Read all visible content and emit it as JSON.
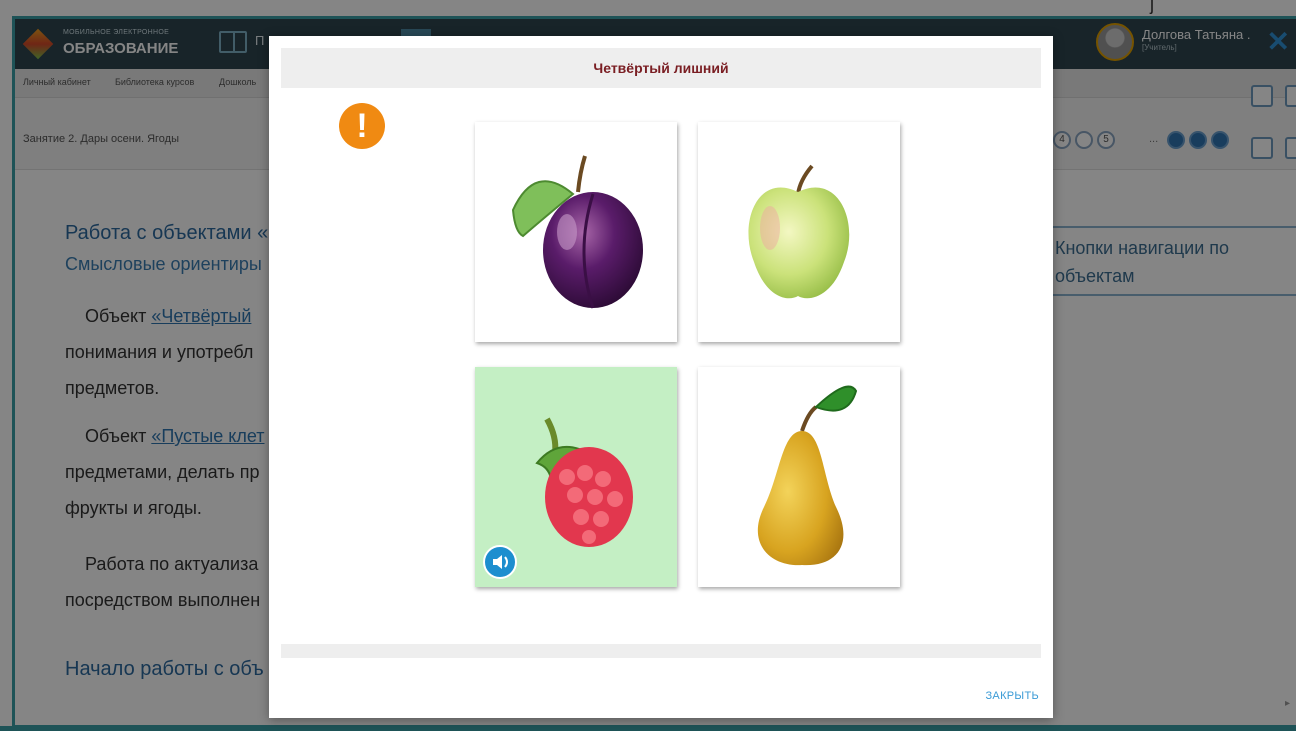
{
  "app": {
    "logo_small": "МОБИЛЬНОЕ ЭЛЕКТРОННОЕ",
    "logo_big": "ОБРАЗОВАНИЕ",
    "nav_label": "П",
    "user_name": "Долгова Татьяна .",
    "user_role": "[Учитель]"
  },
  "breadcrumbs": [
    "Личный кабинет",
    "Библиотека курсов",
    "Дошколь"
  ],
  "lesson_title": "Занятие 2. Дары осени. Ягоды",
  "pager": {
    "four": "4",
    "five": "5",
    "dots": "..."
  },
  "content": {
    "heading_work": "Работа с объектами «",
    "subheading": "Смысловые ориентиры",
    "p1_start": "Объект ",
    "p1_link": "«Четвёртый",
    "p1_line2": "понимания и употребл",
    "p1_line3": "предметов.",
    "p2_start": "Объект ",
    "p2_link": "«Пустые клет",
    "p2_line2": "предметами, делать пр",
    "p2_line3": "фрукты и ягоды.",
    "p3_line1": "Работа по актуализа",
    "p3_line2": "посредством выполнен",
    "heading_start": "Начало работы с объ",
    "nav_note": "Кнопки навигации по объектам"
  },
  "modal": {
    "title": "Четвёртый лишний",
    "warning_glyph": "!",
    "close_label": "ЗАКРЫТЬ",
    "cards": [
      {
        "name": "plum",
        "selected": false
      },
      {
        "name": "apple",
        "selected": false
      },
      {
        "name": "raspberry",
        "selected": true
      },
      {
        "name": "pear",
        "selected": false
      }
    ],
    "selected_bg": "#c4efc4"
  },
  "colors": {
    "topbar": "#2e4650",
    "accent": "#3aa0a8",
    "modal_title": "#7a1e23",
    "link": "#2e76b0",
    "warning": "#f08a12"
  }
}
